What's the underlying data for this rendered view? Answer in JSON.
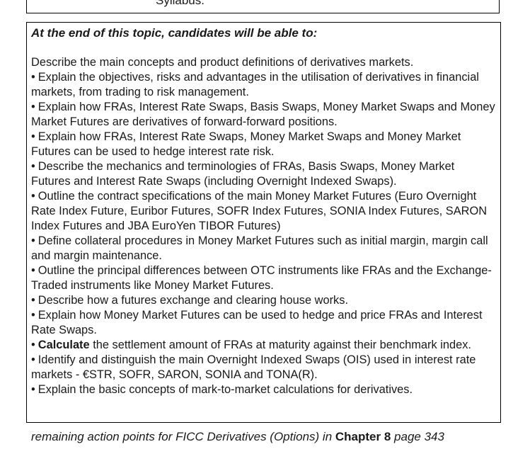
{
  "top_box": {
    "fragment_text": "Syllabus."
  },
  "objectives": {
    "heading": "At the end of this topic, candidates will be able to:",
    "intro": "Describe the main concepts and product definitions of derivatives markets.",
    "bullet_glyph": "•",
    "items": [
      {
        "text": "Explain the objectives, risks and advantages in the utilisation of derivatives in financial markets, from trading to risk management."
      },
      {
        "text": "Explain how FRAs, Interest Rate Swaps, Basis Swaps, Money Market Swaps and Money Market Futures are derivatives of forward-forward positions."
      },
      {
        "text": "Explain how FRAs, Interest Rate Swaps, Money Market Swaps and Money Market Futures can be used to hedge interest rate risk."
      },
      {
        "text": "Describe the mechanics and terminologies of FRAs, Basis Swaps, Money Market Futures and Interest Rate Swaps (including Overnight Indexed Swaps)."
      },
      {
        "text": "Outline the contract specifications of the main Money Market Futures (Euro Overnight Rate Index Future, Euribor Futures, SOFR Index Futures, SONIA Index Futures, SARON Index Futures and JBA EuroYen TIBOR Futures)"
      },
      {
        "text": "Define collateral procedures in Money Market Futures such as initial margin, margin call and margin maintenance."
      },
      {
        "text": "Outline the principal differences between OTC instruments like FRAs and the Exchange-Traded instruments like Money Market Futures."
      },
      {
        "text": "Describe how a futures exchange and clearing house works."
      },
      {
        "text": "Explain how Money Market Futures can be used to hedge and price FRAs and Interest Rate Swaps."
      },
      {
        "bold": "Calculate",
        "text": " the settlement amount of FRAs at maturity against their benchmark index."
      },
      {
        "text": "Identify and distinguish the main Overnight Indexed Swaps (OIS) used in interest rate markets - €STR, SOFR, SARON, SONIA and TONA(R)."
      },
      {
        "text": "Explain the basic concepts of mark-to-market calculations for derivatives."
      }
    ]
  },
  "footer": {
    "text_before": "remaining action points for FICC Derivatives (Options) in ",
    "chapter": "Chapter 8",
    "text_after": " page 343"
  }
}
